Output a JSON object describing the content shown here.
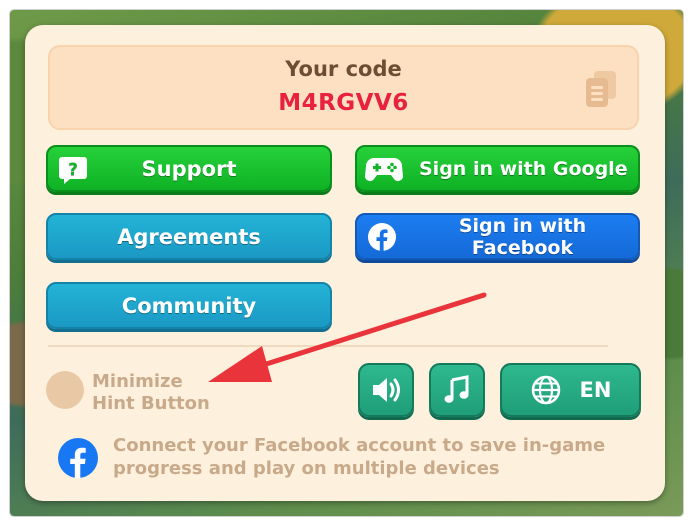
{
  "code": {
    "title": "Your code",
    "value": "M4RGVV6"
  },
  "buttons": {
    "support": "Support",
    "google": "Sign in with Google",
    "agreements": "Agreements",
    "facebook": "Sign in with Facebook",
    "community": "Community"
  },
  "settings": {
    "minimize_hint_label": "Minimize\nHint Button",
    "language": "EN",
    "sound_icon": "speaker-icon",
    "music_icon": "music-note-icon",
    "language_icon": "globe-icon"
  },
  "facebook_note": "Connect your Facebook account to save in-game progress and play on multiple devices",
  "colors": {
    "code_value": "#e8213e",
    "green_button": "#16bf2e",
    "teal_button": "#1fa6cd",
    "facebook_blue": "#1877f2",
    "settings_button": "#25aa82",
    "annotation_arrow": "#e8343a"
  }
}
